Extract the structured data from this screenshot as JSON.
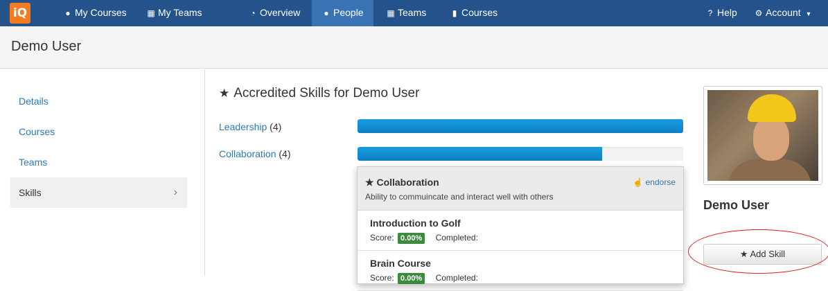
{
  "nav": {
    "logo": "iQ",
    "my_courses": "My Courses",
    "my_teams": "My Teams",
    "overview": "Overview",
    "people": "People",
    "teams": "Teams",
    "courses": "Courses",
    "help": "Help",
    "account": "Account",
    "icons": {
      "my_courses": "user-icon",
      "my_teams": "sitemap-icon",
      "overview": "dashboard-icon",
      "people": "users-icon",
      "teams": "sitemap-icon",
      "courses": "book-icon",
      "help": "question-icon",
      "account": "gear-icon"
    }
  },
  "page": {
    "title": "Demo User"
  },
  "sidebar": {
    "items": [
      {
        "label": "Details"
      },
      {
        "label": "Courses"
      },
      {
        "label": "Teams"
      },
      {
        "label": "Skills",
        "active": true
      }
    ]
  },
  "skills": {
    "heading": "Accredited Skills for Demo User",
    "list": [
      {
        "name": "Leadership",
        "count": "(4)",
        "progress": 1.0
      },
      {
        "name": "Collaboration",
        "count": "(4)",
        "progress": 0.75
      }
    ]
  },
  "popover": {
    "title": "Collaboration",
    "description": "Ability to commuincate and interact well with others",
    "endorse": "endorse",
    "courses": [
      {
        "name": "Introduction to Golf",
        "score_label": "Score:",
        "score": "0.00%",
        "completed_label": "Completed:"
      },
      {
        "name": "Brain Course",
        "score_label": "Score:",
        "score": "0.00%",
        "completed_label": "Completed:"
      }
    ]
  },
  "profile": {
    "name": "Demo User",
    "add_skill": "Add Skill"
  },
  "colors": {
    "nav_bg": "#23538a",
    "nav_active": "#3a73b3",
    "logo": "#f47b20",
    "link": "#2a7ab8",
    "bar": "#1a9be0",
    "score_badge": "#3c8a3c",
    "highlight": "#e01f1f"
  }
}
